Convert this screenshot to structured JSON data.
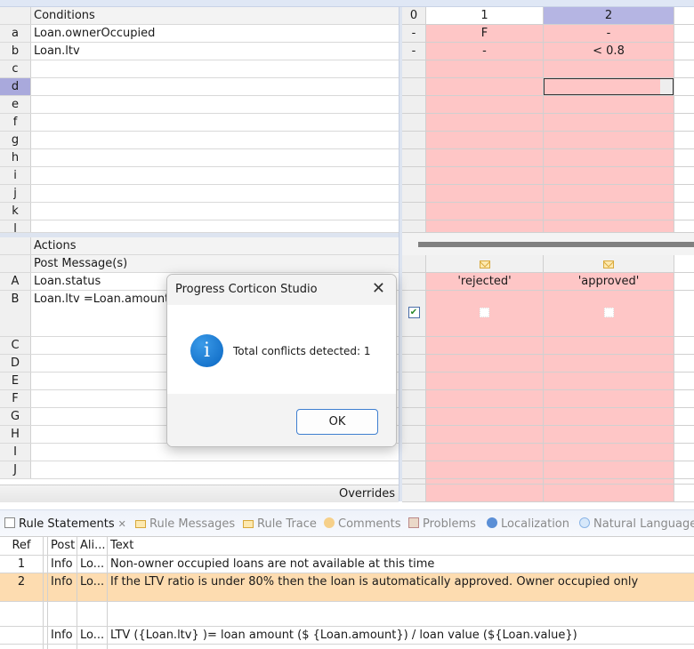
{
  "conditions": {
    "header": "Conditions",
    "rows": [
      {
        "id": "a",
        "expr": "Loan.ownerOccupied",
        "col0": "-",
        "col1": "F",
        "col2": "-"
      },
      {
        "id": "b",
        "expr": "Loan.ltv",
        "col0": "-",
        "col1": "-",
        "col2": "< 0.8"
      },
      {
        "id": "c",
        "expr": "",
        "col0": "",
        "col1": "",
        "col2": ""
      },
      {
        "id": "d",
        "expr": "",
        "col0": "",
        "col1": "",
        "col2": ""
      },
      {
        "id": "e",
        "expr": "",
        "col0": "",
        "col1": "",
        "col2": ""
      },
      {
        "id": "f",
        "expr": "",
        "col0": "",
        "col1": "",
        "col2": ""
      },
      {
        "id": "g",
        "expr": "",
        "col0": "",
        "col1": "",
        "col2": ""
      },
      {
        "id": "h",
        "expr": "",
        "col0": "",
        "col1": "",
        "col2": ""
      },
      {
        "id": "i",
        "expr": "",
        "col0": "",
        "col1": "",
        "col2": ""
      },
      {
        "id": "j",
        "expr": "",
        "col0": "",
        "col1": "",
        "col2": ""
      },
      {
        "id": "k",
        "expr": "",
        "col0": "",
        "col1": "",
        "col2": ""
      },
      {
        "id": "l",
        "expr": "",
        "col0": "",
        "col1": "",
        "col2": ""
      }
    ],
    "selected_row": "d"
  },
  "rule_columns": [
    "0",
    "1",
    "2"
  ],
  "selected_column": "2",
  "actions": {
    "header": "Actions",
    "post_message_label": "Post Message(s)",
    "rows": [
      {
        "id": "A",
        "expr": "Loan.status",
        "col1": "'rejected'",
        "col2": "'approved'"
      },
      {
        "id": "B",
        "expr": "Loan.ltv =Loan.amount /",
        "col1": "",
        "col2": ""
      },
      {
        "id": "C",
        "expr": ""
      },
      {
        "id": "D",
        "expr": ""
      },
      {
        "id": "E",
        "expr": ""
      },
      {
        "id": "F",
        "expr": ""
      },
      {
        "id": "G",
        "expr": ""
      },
      {
        "id": "H",
        "expr": ""
      },
      {
        "id": "I",
        "expr": ""
      },
      {
        "id": "J",
        "expr": ""
      }
    ],
    "overrides_label": "Overrides"
  },
  "dialog": {
    "title": "Progress Corticon Studio",
    "message": "Total conflicts detected: 1",
    "ok_label": "OK",
    "close_glyph": "✕",
    "icon_glyph": "i"
  },
  "bottom_tabs": [
    {
      "label": "Rule Statements",
      "icon": "document-icon",
      "active": true
    },
    {
      "label": "Rule Messages",
      "icon": "envelope-icon",
      "active": false
    },
    {
      "label": "Rule Trace",
      "icon": "envelope-icon",
      "active": false
    },
    {
      "label": "Comments",
      "icon": "comment-icon",
      "active": false
    },
    {
      "label": "Problems",
      "icon": "problems-icon",
      "active": false
    },
    {
      "label": "Localization",
      "icon": "globe-icon",
      "active": false
    },
    {
      "label": "Natural Language",
      "icon": "speech-bubble-icon",
      "active": false
    }
  ],
  "tab_close_glyph": "✕",
  "statements": {
    "columns": [
      "Ref",
      "Post",
      "Ali...",
      "Text"
    ],
    "rows": [
      {
        "ref": "1",
        "post": "Info",
        "alias": "Lo...",
        "text": "Non-owner occupied loans are not available at this time",
        "highlight": false
      },
      {
        "ref": "2",
        "post": "Info",
        "alias": "Lo...",
        "text": "If the LTV ratio is under 80% then the loan is automatically approved. Owner occupied only",
        "highlight": true
      },
      {
        "ref": "",
        "post": "",
        "alias": "",
        "text": "",
        "highlight": false
      },
      {
        "ref": "",
        "post": "Info",
        "alias": "Lo...",
        "text": "LTV ({Loan.ltv} )= loan amount ($ {Loan.amount}) / loan value (${Loan.value})",
        "highlight": false
      }
    ]
  },
  "colors": {
    "conflict_cell": "#fec6c6",
    "selected_header": "#a9a9dc",
    "highlight_row": "#fddcb0",
    "info_icon": "#0a66c2"
  }
}
